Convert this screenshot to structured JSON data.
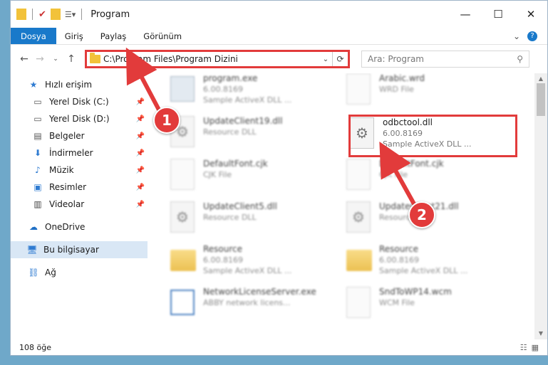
{
  "window": {
    "title": "Program"
  },
  "ribbon": {
    "tabs": [
      "Dosya",
      "Giriş",
      "Paylaş",
      "Görünüm"
    ]
  },
  "address": {
    "path": "C:\\Program Files\\Program Dizini"
  },
  "search": {
    "placeholder": "Ara: Program"
  },
  "sidebar": {
    "quick_access": "Hızlı erişim",
    "items": [
      "Yerel Disk (C:)",
      "Yerel Disk (D:)",
      "Belgeler",
      "İndirmeler",
      "Müzik",
      "Resimler",
      "Videolar"
    ],
    "onedrive": "OneDrive",
    "this_pc": "Bu bilgisayar",
    "network": "Ağ"
  },
  "files": [
    {
      "name": "program.exe",
      "sub1": "6.00.8169",
      "sub2": "Sample ActiveX DLL ..."
    },
    {
      "name": "Arabic.wrd",
      "sub1": "WRD File",
      "sub2": ""
    },
    {
      "name": "UpdateClient19.dll",
      "sub1": "Resource DLL",
      "sub2": ""
    },
    {
      "name": "odbctool.dll",
      "sub1": "6.00.8169",
      "sub2": "Sample ActiveX DLL ..."
    },
    {
      "name": "DefaultFont.cjk",
      "sub1": "CJK File",
      "sub2": ""
    },
    {
      "name": "DefaultFont.cjk",
      "sub1": "CJK File",
      "sub2": ""
    },
    {
      "name": "UpdateClient5.dll",
      "sub1": "Resource DLL",
      "sub2": ""
    },
    {
      "name": "UpdateClient21.dll",
      "sub1": "Resource DLL",
      "sub2": ""
    },
    {
      "name": "Resource",
      "sub1": "6.00.8169",
      "sub2": "Sample ActiveX DLL ..."
    },
    {
      "name": "Resource",
      "sub1": "6.00.8169",
      "sub2": "Sample ActiveX DLL ..."
    },
    {
      "name": "NetworkLicenseServer.exe",
      "sub1": "ABBY network licens...",
      "sub2": ""
    },
    {
      "name": "SndToWP14.wcm",
      "sub1": "WCM File",
      "sub2": ""
    }
  ],
  "callouts": [
    "1",
    "2"
  ],
  "status": {
    "count": "108 öğe"
  },
  "colors": {
    "accent": "#1979ca",
    "highlight": "#e23b3b"
  }
}
